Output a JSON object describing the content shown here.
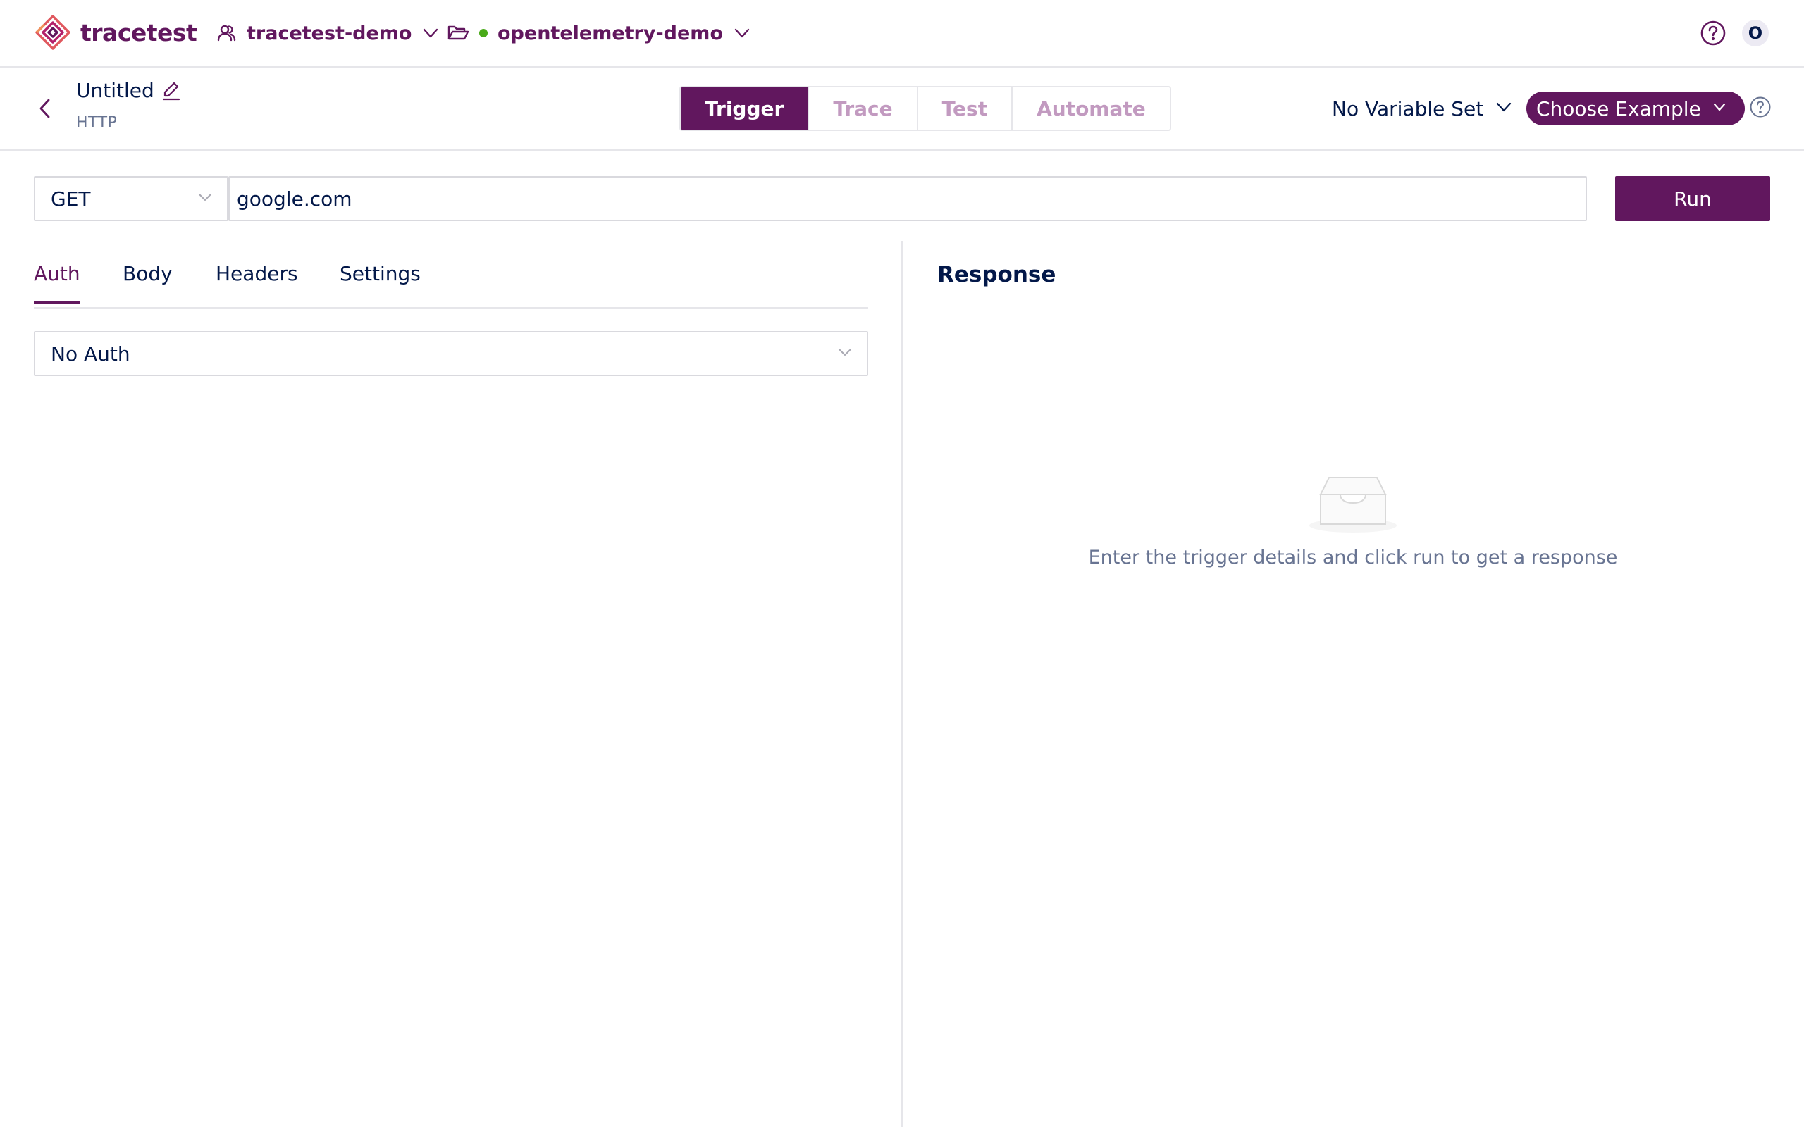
{
  "topbar": {
    "logo_text": "tracetest",
    "organization": "tracetest-demo",
    "environment": "opentelemetry-demo",
    "avatar_initial": "O"
  },
  "header": {
    "test_name": "Untitled",
    "test_type": "HTTP",
    "mode_tabs": [
      {
        "label": "Trigger",
        "active": true
      },
      {
        "label": "Trace",
        "active": false
      },
      {
        "label": "Test",
        "active": false
      },
      {
        "label": "Automate",
        "active": false
      }
    ],
    "variable_set": "No Variable Set",
    "choose_example": "Choose Example"
  },
  "request": {
    "method": "GET",
    "url": "google.com",
    "run_label": "Run"
  },
  "request_tabs": [
    {
      "label": "Auth",
      "active": true
    },
    {
      "label": "Body",
      "active": false
    },
    {
      "label": "Headers",
      "active": false
    },
    {
      "label": "Settings",
      "active": false
    }
  ],
  "auth": {
    "selected": "No Auth"
  },
  "response": {
    "title": "Response",
    "empty_message": "Enter the trigger details and click run to get a response"
  },
  "colors": {
    "brand": "#61175e",
    "text": "#031849",
    "muted": "#687492",
    "tab_inactive": "#c29ac0",
    "status_online": "#49aa19",
    "border": "#d9d9de"
  },
  "icons": {
    "logo": "tracetest-logo-icon",
    "organization": "user-group-icon",
    "environment": "folder-open-icon",
    "help": "question-circle-icon",
    "back": "chevron-left-icon",
    "edit": "edit-pencil-icon",
    "dropdown": "chevron-down-icon",
    "empty": "inbox-icon"
  }
}
